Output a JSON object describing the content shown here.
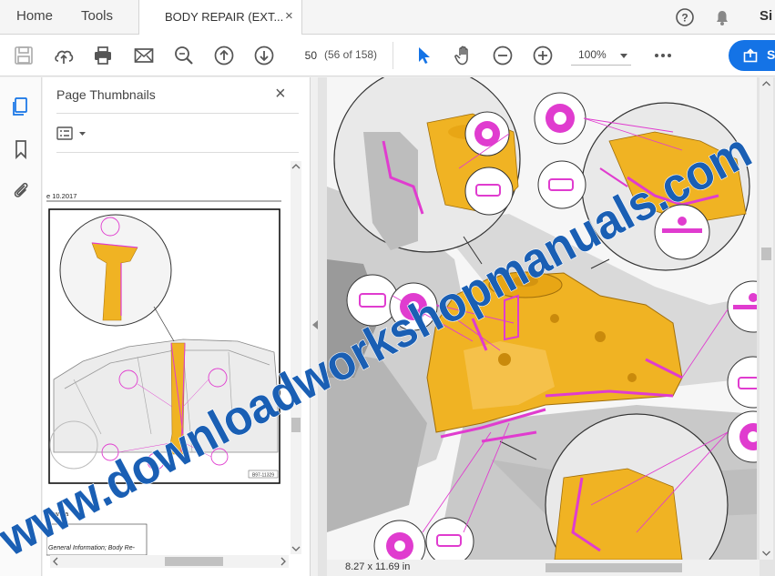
{
  "tabs": {
    "home_label": "Home",
    "tools_label": "Tools",
    "document_tab_label": "BODY REPAIR (EXT...",
    "document_tab_close": "×",
    "sign_in_label": "Si"
  },
  "toolbar": {
    "page_number": "50",
    "page_count": "(56 of 158)",
    "zoom_value": "100%",
    "share_label": "S"
  },
  "panel": {
    "title": "Page Thumbnails",
    "close_glyph": "×"
  },
  "thumbnail": {
    "date_fragment": "e 10.2017",
    "figure_code": "B97-11329",
    "footer_fragment": "new pa",
    "footer_link": "General Information; Body Re-"
  },
  "document": {
    "page_size": "8.27 x 11.69 in"
  },
  "watermark": {
    "text": "www.downloadworkshopmanuals.com",
    "color": "#1a5fb4"
  },
  "colors": {
    "accent_blue": "#1473e6",
    "part_yellow": "#f0b323",
    "weld_magenta": "#e03ccf"
  },
  "icons": {
    "save": "save-icon",
    "cloud_upload": "cloud-upload-icon",
    "print": "print-icon",
    "mail": "mail-icon",
    "zoom_search": "zoom-search-icon",
    "prev_page": "arrow-up-circle-icon",
    "next_page": "arrow-down-circle-icon",
    "select": "cursor-icon",
    "hand": "hand-icon",
    "zoom_out": "zoom-out-icon",
    "zoom_in": "zoom-in-icon",
    "more": "more-icon",
    "help": "help-icon",
    "notifications": "bell-icon"
  }
}
